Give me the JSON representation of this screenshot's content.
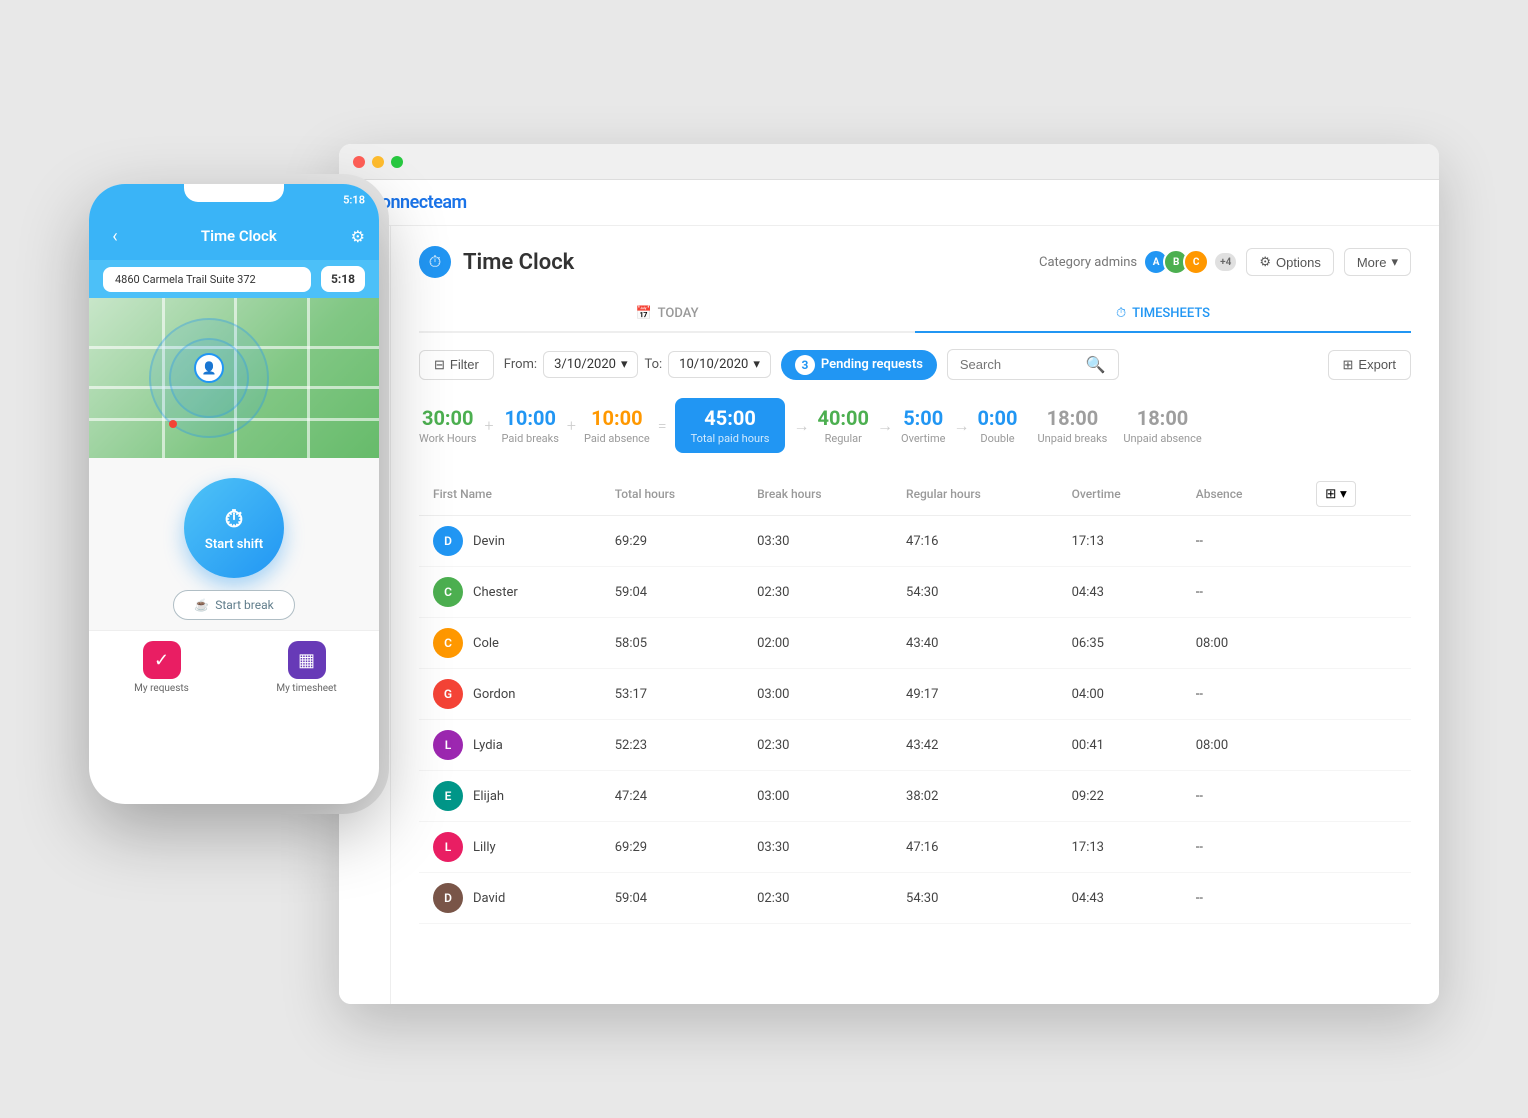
{
  "app": {
    "logo": "connecteam",
    "page_title": "Time Clock",
    "category_admins_label": "Category admins",
    "admin_count": "+4"
  },
  "header_buttons": {
    "options": "Options",
    "more": "More"
  },
  "tabs": [
    {
      "id": "today",
      "label": "TODAY",
      "icon": "📅",
      "active": false
    },
    {
      "id": "timesheets",
      "label": "TIMESHEETS",
      "icon": "⏱",
      "active": true
    }
  ],
  "toolbar": {
    "filter_label": "Filter",
    "from_label": "From:",
    "from_date": "3/10/2020",
    "to_label": "To:",
    "to_date": "10/10/2020",
    "pending_count": "3",
    "pending_label": "Pending requests",
    "search_placeholder": "Search",
    "export_label": "Export"
  },
  "stats": [
    {
      "id": "work-hours",
      "value": "30:00",
      "label": "Work Hours",
      "class": "stat-green"
    },
    {
      "id": "paid-breaks",
      "value": "10:00",
      "label": "Paid breaks",
      "class": "stat-blue"
    },
    {
      "id": "paid-absence",
      "value": "10:00",
      "label": "Paid absence",
      "class": "stat-orange"
    },
    {
      "id": "total-paid",
      "value": "45:00",
      "label": "Total paid hours",
      "class": "stat-total"
    },
    {
      "id": "regular",
      "value": "40:00",
      "label": "Regular",
      "class": "stat-reg"
    },
    {
      "id": "overtime",
      "value": "5:00",
      "label": "Overtime",
      "class": "stat-ot"
    },
    {
      "id": "double",
      "value": "0:00",
      "label": "Double",
      "class": "stat-double"
    },
    {
      "id": "unpaid-breaks",
      "value": "18:00",
      "label": "Unpaid breaks",
      "class": "stat-unpaid-brk"
    },
    {
      "id": "unpaid-absence",
      "value": "18:00",
      "label": "Unpaid absence",
      "class": "stat-unpaid-abs"
    }
  ],
  "table": {
    "columns": [
      "First Name",
      "Total hours",
      "Break hours",
      "Regular hours",
      "Overtime",
      "Absence"
    ],
    "rows": [
      {
        "name": "Devin",
        "total": "69:29",
        "break": "03:30",
        "regular": "47:16",
        "overtime": "17:13",
        "absence": "--",
        "color": "av-blue",
        "initials": "D"
      },
      {
        "name": "Chester",
        "total": "59:04",
        "break": "02:30",
        "regular": "54:30",
        "overtime": "04:43",
        "absence": "--",
        "color": "av-green",
        "initials": "C"
      },
      {
        "name": "Cole",
        "total": "58:05",
        "break": "02:00",
        "regular": "43:40",
        "overtime": "06:35",
        "absence": "08:00",
        "color": "av-orange",
        "initials": "C"
      },
      {
        "name": "Gordon",
        "total": "53:17",
        "break": "03:00",
        "regular": "49:17",
        "overtime": "04:00",
        "absence": "--",
        "color": "av-red",
        "initials": "G"
      },
      {
        "name": "Lydia",
        "total": "52:23",
        "break": "02:30",
        "regular": "43:42",
        "overtime": "00:41",
        "absence": "08:00",
        "color": "av-purple",
        "initials": "L"
      },
      {
        "name": "Elijah",
        "total": "47:24",
        "break": "03:00",
        "regular": "38:02",
        "overtime": "09:22",
        "absence": "--",
        "color": "av-teal",
        "initials": "E"
      },
      {
        "name": "Lilly",
        "total": "69:29",
        "break": "03:30",
        "regular": "47:16",
        "overtime": "17:13",
        "absence": "--",
        "color": "av-pink",
        "initials": "L"
      },
      {
        "name": "David",
        "total": "59:04",
        "break": "02:30",
        "regular": "54:30",
        "overtime": "04:43",
        "absence": "--",
        "color": "av-brown",
        "initials": "D"
      }
    ]
  },
  "mobile": {
    "screen_title": "Time Clock",
    "status_time": "5:18",
    "address": "4860 Carmela Trail Suite 372",
    "start_shift_label": "Start shift",
    "start_break_label": "Start break",
    "nav_items": [
      {
        "label": "My requests",
        "icon": "✓",
        "color": "nav-pink"
      },
      {
        "label": "My timesheet",
        "icon": "▦",
        "color": "nav-purple"
      }
    ]
  }
}
